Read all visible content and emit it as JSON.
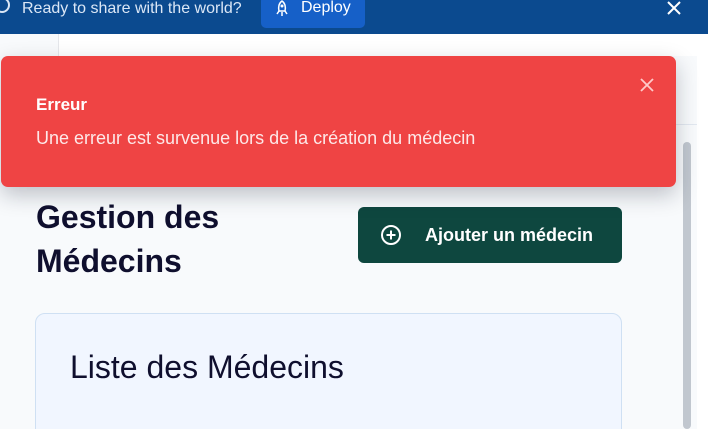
{
  "topbar": {
    "message": "Ready to share with the world?",
    "deploy_label": "Deploy",
    "close_icon": "close-icon",
    "deploy_icon": "rocket-icon"
  },
  "toast": {
    "title": "Erreur",
    "message": "Une erreur est survenue lors de la création du médecin",
    "close_icon": "close-icon",
    "color": "#ef4444"
  },
  "page": {
    "title": "Gestion des Médecins",
    "add_button_label": "Ajouter un médecin",
    "add_icon": "plus-circle-icon",
    "accent": "#0e473f"
  },
  "card": {
    "title": "Liste des Médecins"
  }
}
